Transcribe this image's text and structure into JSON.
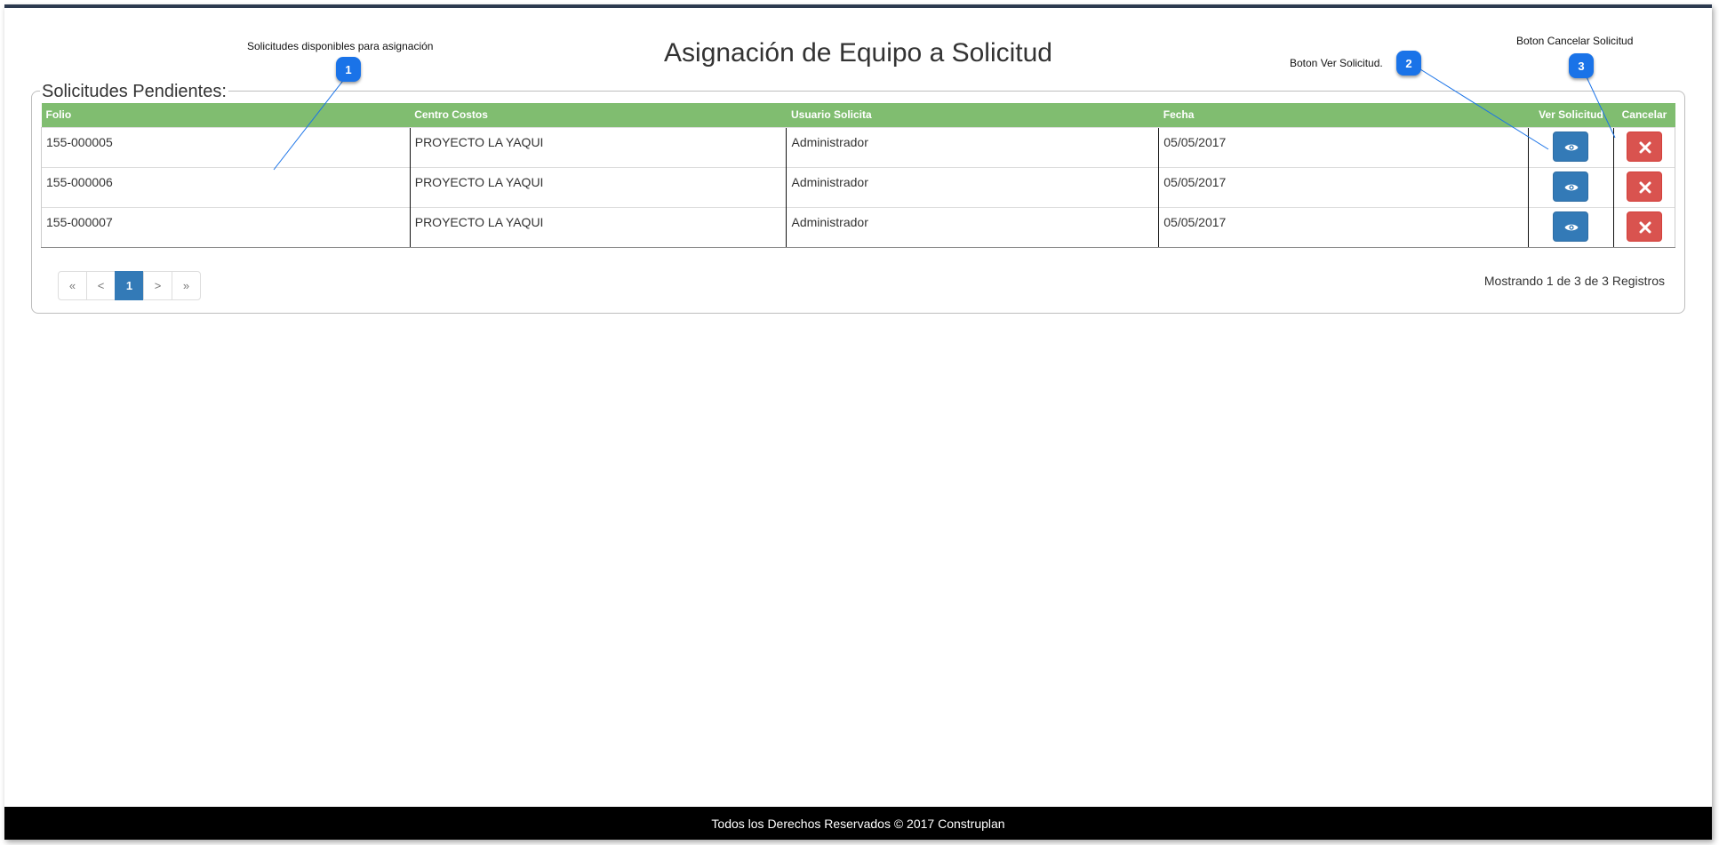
{
  "page": {
    "title": "Asignación de Equipo a Solicitud",
    "section_legend": "Solicitudes Pendientes:"
  },
  "table": {
    "headers": {
      "folio": "Folio",
      "centro_costos": "Centro Costos",
      "usuario_solicita": "Usuario Solicita",
      "fecha": "Fecha",
      "ver_solicitud": "Ver Solicitud",
      "cancelar": "Cancelar"
    },
    "rows": [
      {
        "folio": "155-000005",
        "centro_costos": "PROYECTO LA YAQUI",
        "usuario_solicita": "Administrador",
        "fecha": "05/05/2017"
      },
      {
        "folio": "155-000006",
        "centro_costos": "PROYECTO LA YAQUI",
        "usuario_solicita": "Administrador",
        "fecha": "05/05/2017"
      },
      {
        "folio": "155-000007",
        "centro_costos": "PROYECTO LA YAQUI",
        "usuario_solicita": "Administrador",
        "fecha": "05/05/2017"
      }
    ]
  },
  "pagination": {
    "first": "«",
    "prev": "<",
    "current": "1",
    "next": ">",
    "last": "»",
    "info": "Mostrando 1 de 3 de 3 Registros"
  },
  "footer": {
    "text": "Todos los Derechos Reservados © 2017 Construplan"
  },
  "callouts": [
    {
      "number": "1",
      "label": "Solicitudes disponibles para asignación"
    },
    {
      "number": "2",
      "label": "Boton Ver Solicitud."
    },
    {
      "number": "3",
      "label": "Boton Cancelar Solicitud"
    }
  ],
  "icons": {
    "view": "eye-icon",
    "cancel": "x-icon"
  },
  "colors": {
    "header_green": "#80bd70",
    "view_blue": "#337ab7",
    "cancel_red": "#d9534f",
    "callout_blue": "#1a73e8",
    "footer_black": "#000000"
  }
}
